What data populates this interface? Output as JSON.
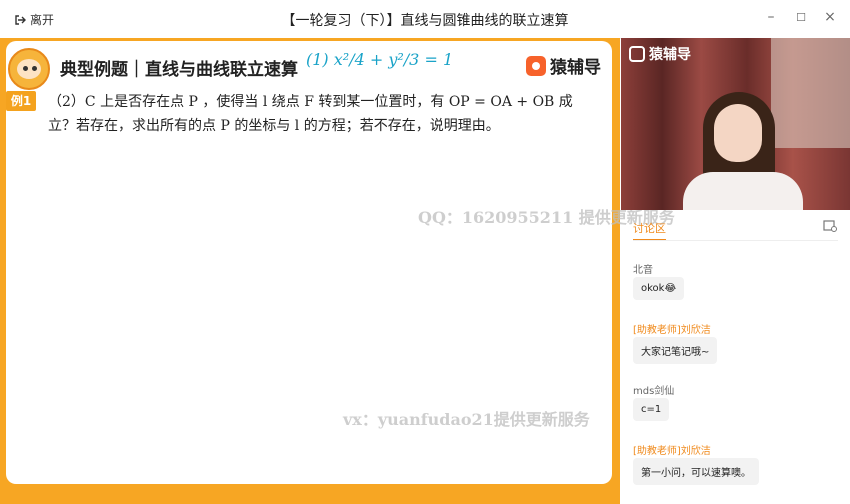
{
  "window": {
    "leave_label": "离开",
    "title": "【一轮复习（下）】直线与圆锥曲线的联立速算",
    "controls": {
      "minimize": "–",
      "maximize": "☐",
      "close": "×"
    }
  },
  "slide": {
    "title": "典型例题｜直线与曲线联立速算",
    "handwriting": "(1) x²/4 + y²/3 = 1",
    "brand": "猿辅导",
    "example_tag": "例1",
    "problem_line1": "（2）C 上是否存在点 P ，使得当 l 绕点 F 转到某一位置时，有 OP = OA + OB 成",
    "problem_line2": "立？若存在，求出所有的点 P 的坐标与 l 的方程；若不存在，说明理由。"
  },
  "watermarks": {
    "qq": "QQ：1620955211  提供更新服务",
    "vx": "vx：yuanfudao21提供更新服务"
  },
  "video": {
    "logo": "猿辅导"
  },
  "discussion": {
    "tab_label": "讨论区",
    "messages": [
      {
        "name": "北音",
        "text": "okok😂",
        "assistant": false
      },
      {
        "name": "[助教老师]刘欣洁",
        "text": "大家记笔记哦~",
        "assistant": true
      },
      {
        "name": "mds剑仙",
        "text": "c=1",
        "assistant": false
      },
      {
        "name": "[助教老师]刘欣洁",
        "text": "第一小问，可以速算噢。",
        "assistant": true
      }
    ]
  },
  "colors": {
    "accent": "#f7a623",
    "assistant_name": "#f08a1c",
    "brand": "#f7622b"
  }
}
